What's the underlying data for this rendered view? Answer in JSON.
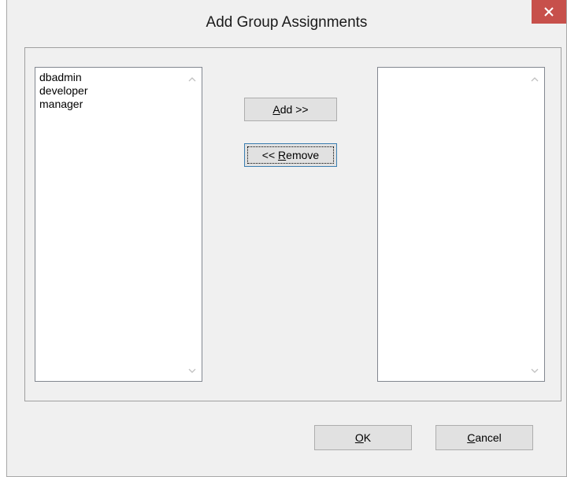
{
  "dialog": {
    "title": "Add Group Assignments",
    "close_glyph": "×"
  },
  "available_list": {
    "items": [
      "dbadmin",
      "developer",
      "manager"
    ]
  },
  "assigned_list": {
    "items": []
  },
  "buttons": {
    "add": {
      "mnemonic": "A",
      "rest": "dd >>"
    },
    "remove": {
      "prefix": "<< ",
      "mnemonic": "R",
      "rest": "emove"
    },
    "ok": {
      "mnemonic": "O",
      "rest": "K"
    },
    "cancel": {
      "mnemonic": "C",
      "rest": "ancel"
    }
  },
  "colors": {
    "close_button": "#c7504b",
    "dialog_background": "#f0f0f0",
    "focus_border": "#3c7fb1"
  }
}
